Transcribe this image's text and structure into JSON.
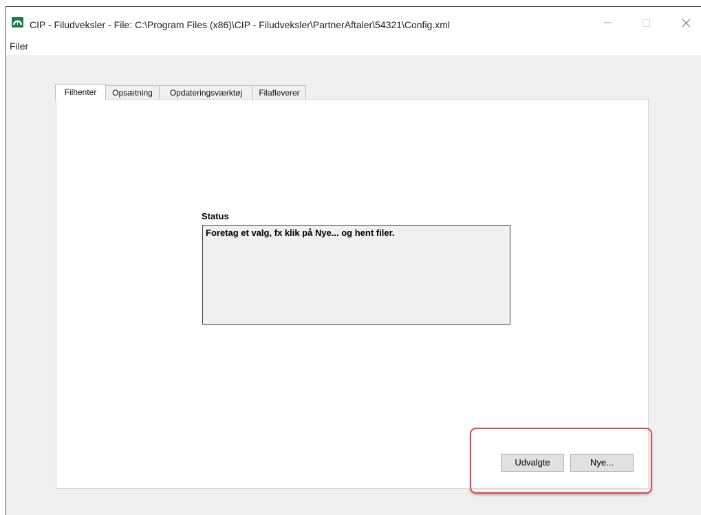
{
  "window": {
    "title": "CIP - Filudveksler - File: C:\\Program Files (x86)\\CIP - Filudveksler\\PartnerAftaler\\54321\\Config.xml",
    "app_icon": "cip-app-icon",
    "controls": [
      "minimize-icon",
      "maximize-icon",
      "close-icon"
    ]
  },
  "menubar": {
    "items": [
      {
        "label": "Filer"
      }
    ]
  },
  "tabs": [
    {
      "label": "Filhenter",
      "active": true
    },
    {
      "label": "Opsætning",
      "active": false
    },
    {
      "label": "Opdateringsværktøj",
      "active": false
    },
    {
      "label": "Filafleverer",
      "active": false
    }
  ],
  "status": {
    "label": "Status",
    "text": "Foretag et valg, fx klik på Nye... og hent filer."
  },
  "buttons": {
    "selected_label": "Udvalgte",
    "new_label": "Nye..."
  },
  "colors": {
    "app_icon_bg": "#1f7a4d",
    "highlight": "#e0474c",
    "window_bg": "#f0f0f0"
  }
}
